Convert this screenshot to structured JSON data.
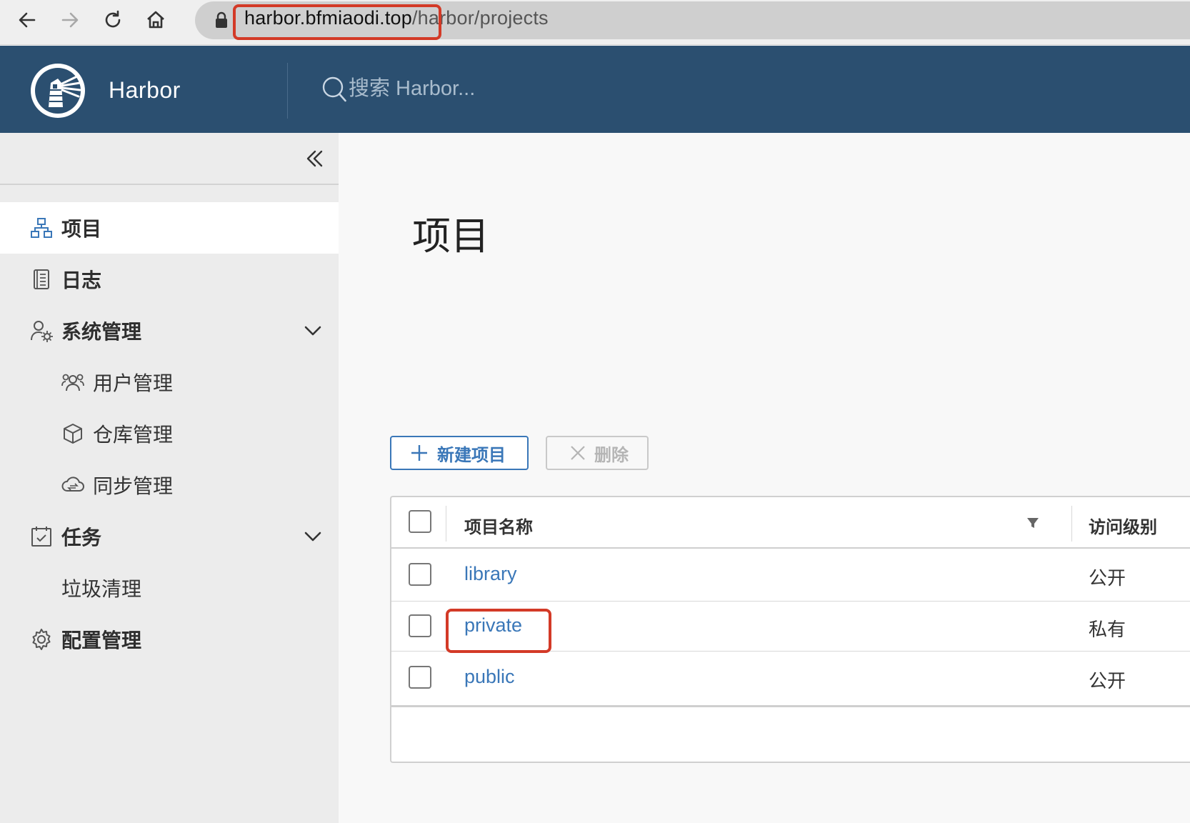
{
  "browser": {
    "url_host": "harbor.bfmiaodi.top",
    "url_path": "/harbor/projects"
  },
  "header": {
    "app_title": "Harbor",
    "search_placeholder": "搜索 Harbor..."
  },
  "sidebar": {
    "items": [
      {
        "label": "项目",
        "icon": "projects-icon",
        "active": true
      },
      {
        "label": "日志",
        "icon": "logs-icon"
      },
      {
        "label": "系统管理",
        "icon": "admin-icon",
        "expandable": true
      },
      {
        "label": "用户管理",
        "icon": "users-icon",
        "child": true
      },
      {
        "label": "仓库管理",
        "icon": "box-icon",
        "child": true
      },
      {
        "label": "同步管理",
        "icon": "cloud-sync-icon",
        "child": true
      },
      {
        "label": "任务",
        "icon": "tasks-icon",
        "expandable": true
      },
      {
        "label": "垃圾清理",
        "child": true
      },
      {
        "label": "配置管理",
        "icon": "gear-icon"
      }
    ]
  },
  "main": {
    "title": "项目",
    "new_button": "新建项目",
    "delete_button": "删除",
    "table": {
      "columns": [
        "项目名称",
        "访问级别"
      ],
      "rows": [
        {
          "name": "library",
          "access": "公开"
        },
        {
          "name": "private",
          "access": "私有"
        },
        {
          "name": "public",
          "access": "公开"
        }
      ]
    }
  },
  "colors": {
    "header_bg": "#2b4f70",
    "link": "#3a77b8",
    "highlight": "#d33a27"
  }
}
